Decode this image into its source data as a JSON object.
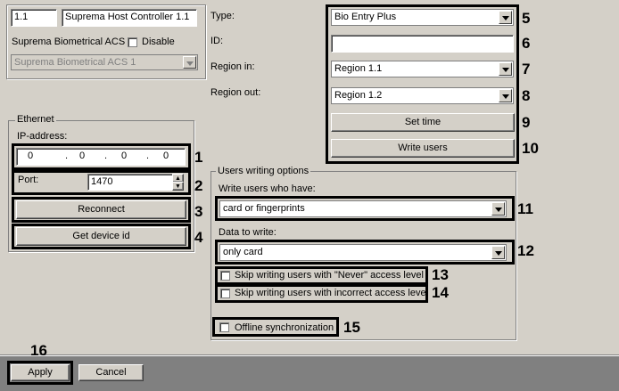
{
  "device": {
    "id": "1.1",
    "name": "Suprema Host Controller 1.1",
    "parent_label": "Suprema Biometrical ACS",
    "disable_label": "Disable",
    "parent_value": "Suprema Biometrical ACS 1"
  },
  "ethernet": {
    "title": "Ethernet",
    "ip_label": "IP-address:",
    "ip": [
      "0",
      "0",
      "0",
      "0"
    ],
    "port_label": "Port:",
    "port": "1470",
    "reconnect_label": "Reconnect",
    "get_id_label": "Get device id"
  },
  "settings": {
    "type_label": "Type:",
    "type_value": "Bio Entry Plus",
    "id_label": "ID:",
    "id_value": "",
    "region_in_label": "Region in:",
    "region_in_value": "Region 1.1",
    "region_out_label": "Region out:",
    "region_out_value": "Region 1.2",
    "set_time_label": "Set time",
    "write_users_label": "Write users"
  },
  "users_writing": {
    "title": "Users writing options",
    "who_label": "Write users who have:",
    "who_value": "card or fingerprints",
    "data_label": "Data to write:",
    "data_value": "only card",
    "skip_never_label": "Skip writing users with \"Never\" access level",
    "skip_incorrect_label": "Skip writing users with incorrect access level",
    "offline_label": "Offline synchronization"
  },
  "footer": {
    "apply_label": "Apply",
    "cancel_label": "Cancel"
  },
  "callouts": [
    "1",
    "2",
    "3",
    "4",
    "5",
    "6",
    "7",
    "8",
    "9",
    "10",
    "11",
    "12",
    "13",
    "14",
    "15",
    "16"
  ]
}
